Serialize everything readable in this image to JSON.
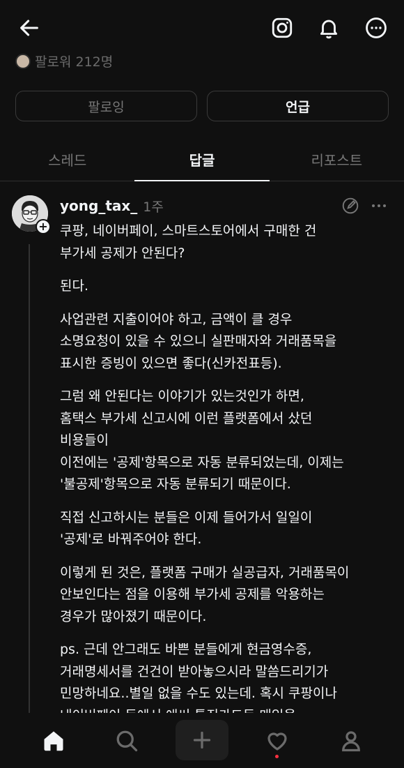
{
  "header": {
    "icons": [
      "back-arrow-icon",
      "instagram-icon",
      "bell-icon",
      "more-circle-icon"
    ]
  },
  "profile": {
    "followers_text": "팔로워 212명"
  },
  "actions": {
    "follow_label": "팔로잉",
    "mention_label": "언급"
  },
  "tabs": [
    {
      "label": "스레드",
      "active": false
    },
    {
      "label": "답글",
      "active": true
    },
    {
      "label": "리포스트",
      "active": false
    }
  ],
  "post": {
    "username": "yong_tax_",
    "time": "1주",
    "paragraphs": [
      "쿠팡, 네이버페이, 스마트스토어에서 구매한 건\n부가세 공제가 안된다?",
      "된다.",
      "사업관련 지출이어야 하고, 금액이 클 경우\n소명요청이 있을 수 있으니 실판매자와 거래품목을\n표시한 증빙이 있으면 좋다(신카전표등).",
      "그럼 왜 안된다는 이야기가 있는것인가 하면,\n홈택스 부가세 신고시에 이런 플랫폼에서 샀던\n비용들이\n이전에는 '공제'항목으로 자동 분류되었는데, 이제는\n'불공제'항목으로 자동 분류되기 때문이다.",
      "직접 신고하시는 분들은 이제 들어가서 일일이\n'공제'로 바꿔주어야 한다.",
      "이렇게 된 것은, 플랫폼 구매가 실공급자, 거래품목이\n안보인다는 점을 이용해 부가세 공제를 악용하는\n경우가 많아졌기 때문이다.",
      "ps. 근데 안그래도 바쁜 분들에게 현금영수증,\n거래명세서를 건건이 받아놓으시라 말씀드리기가\n민망하네요..별일 없을 수도 있는데. 혹시 쿠팡이나\n네이버페이 등에서 애써 틀진카드등 매입을"
    ]
  },
  "bottom_nav": {
    "items": [
      "home-icon",
      "search-icon",
      "plus-icon",
      "heart-icon",
      "profile-icon"
    ],
    "notification_dot_color": "#ff3040"
  }
}
